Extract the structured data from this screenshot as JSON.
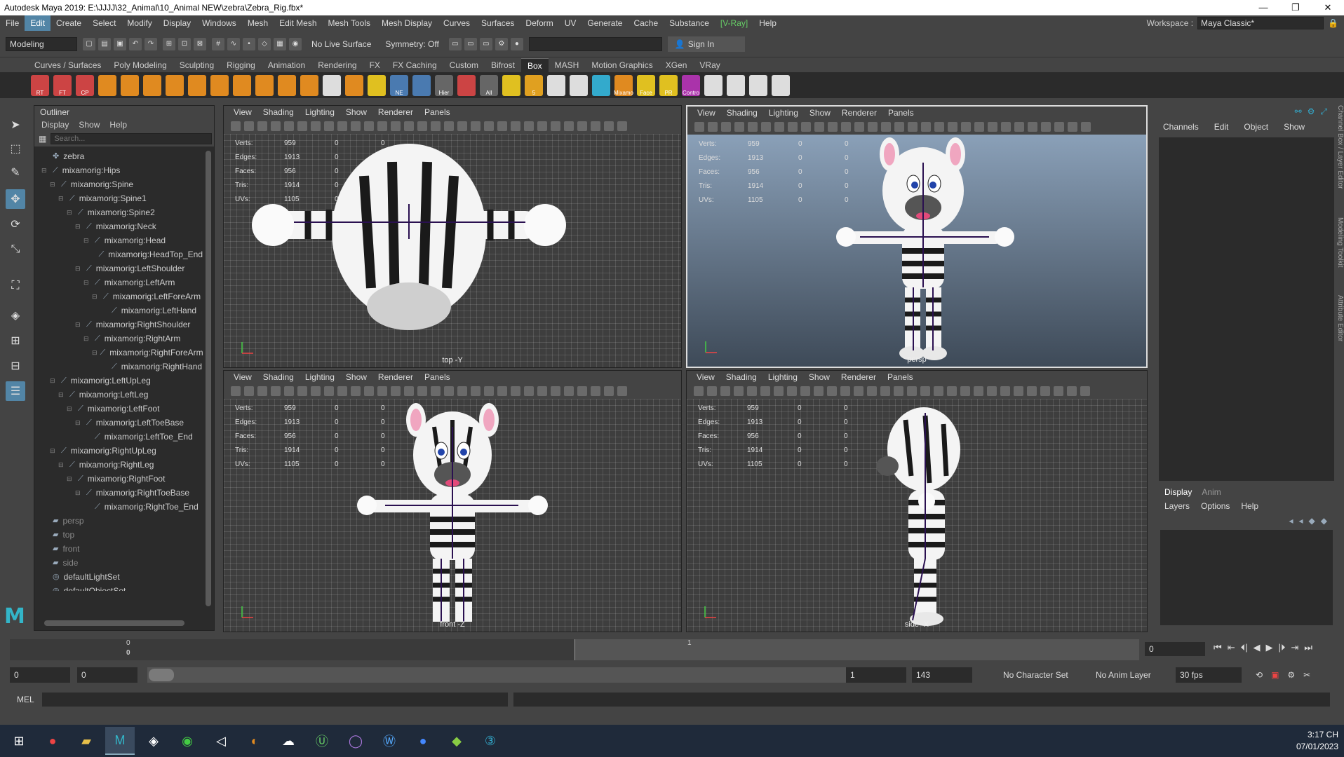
{
  "window": {
    "title": "Autodesk Maya 2019: E:\\JJJJ\\32_Animal\\10_Animal NEW\\zebra\\Zebra_Rig.fbx*",
    "min": "—",
    "max": "❐",
    "close": "✕"
  },
  "menu": [
    "File",
    "Edit",
    "Create",
    "Select",
    "Modify",
    "Display",
    "Windows",
    "Mesh",
    "Edit Mesh",
    "Mesh Tools",
    "Mesh Display",
    "Curves",
    "Surfaces",
    "Deform",
    "UV",
    "Generate",
    "Cache",
    "Substance",
    "[V-Ray]",
    "Help"
  ],
  "workspace": {
    "label": "Workspace :",
    "value": "Maya Classic*"
  },
  "statusline": {
    "mode": "Modeling",
    "live_surface": "No Live Surface",
    "symmetry": "Symmetry: Off",
    "signin": "Sign In"
  },
  "shelf_tabs": [
    "Curves / Surfaces",
    "Poly Modeling",
    "Sculpting",
    "Rigging",
    "Animation",
    "Rendering",
    "FX",
    "FX Caching",
    "Custom",
    "Bifrost",
    "Box",
    "MASH",
    "Motion Graphics",
    "XGen",
    "VRay"
  ],
  "shelf_icons": [
    {
      "label": "RT",
      "color": "#c44"
    },
    {
      "label": "FT",
      "color": "#c44"
    },
    {
      "label": "CP",
      "color": "#c44"
    },
    {
      "label": "",
      "color": "#e08a20"
    },
    {
      "label": "",
      "color": "#e08a20"
    },
    {
      "label": "",
      "color": "#e08a20"
    },
    {
      "label": "",
      "color": "#e08a20"
    },
    {
      "label": "",
      "color": "#e08a20"
    },
    {
      "label": "",
      "color": "#e08a20"
    },
    {
      "label": "",
      "color": "#e08a20"
    },
    {
      "label": "",
      "color": "#e08a20"
    },
    {
      "label": "",
      "color": "#e08a20"
    },
    {
      "label": "",
      "color": "#e08a20"
    },
    {
      "label": "",
      "color": "#ddd"
    },
    {
      "label": "",
      "color": "#e08a20"
    },
    {
      "label": "",
      "color": "#e0c020"
    },
    {
      "label": "NE",
      "color": "#4a7ab0"
    },
    {
      "label": "",
      "color": "#4a7ab0"
    },
    {
      "label": "Hier",
      "color": "#666"
    },
    {
      "label": "",
      "color": "#c44"
    },
    {
      "label": "All",
      "color": "#666"
    },
    {
      "label": "",
      "color": "#e0c020"
    },
    {
      "label": "5",
      "color": "#e0a020"
    },
    {
      "label": "",
      "color": "#ddd"
    },
    {
      "label": "",
      "color": "#ddd"
    },
    {
      "label": "",
      "color": "#3ac"
    },
    {
      "label": "Mixamo",
      "color": "#e08a20"
    },
    {
      "label": "Face",
      "color": "#e0c020"
    },
    {
      "label": "PR",
      "color": "#e0c020"
    },
    {
      "label": "Contro",
      "color": "#a3a"
    },
    {
      "label": "",
      "color": "#ddd"
    },
    {
      "label": "",
      "color": "#ddd"
    },
    {
      "label": "",
      "color": "#ddd"
    },
    {
      "label": "",
      "color": "#ddd"
    }
  ],
  "outliner": {
    "title": "Outliner",
    "menu": [
      "Display",
      "Show",
      "Help"
    ],
    "search_placeholder": "Search...",
    "rows": [
      {
        "label": "zebra",
        "indent": 0,
        "icon": "✤",
        "exp": ""
      },
      {
        "label": "mixamorig:Hips",
        "indent": 0,
        "icon": "⟋",
        "exp": "⊟"
      },
      {
        "label": "mixamorig:Spine",
        "indent": 1,
        "icon": "⟋",
        "exp": "⊟"
      },
      {
        "label": "mixamorig:Spine1",
        "indent": 2,
        "icon": "⟋",
        "exp": "⊟"
      },
      {
        "label": "mixamorig:Spine2",
        "indent": 3,
        "icon": "⟋",
        "exp": "⊟"
      },
      {
        "label": "mixamorig:Neck",
        "indent": 4,
        "icon": "⟋",
        "exp": "⊟"
      },
      {
        "label": "mixamorig:Head",
        "indent": 5,
        "icon": "⟋",
        "exp": "⊟"
      },
      {
        "label": "mixamorig:HeadTop_End",
        "indent": 6,
        "icon": "⟋",
        "exp": ""
      },
      {
        "label": "mixamorig:LeftShoulder",
        "indent": 4,
        "icon": "⟋",
        "exp": "⊟"
      },
      {
        "label": "mixamorig:LeftArm",
        "indent": 5,
        "icon": "⟋",
        "exp": "⊟"
      },
      {
        "label": "mixamorig:LeftForeArm",
        "indent": 6,
        "icon": "⟋",
        "exp": "⊟"
      },
      {
        "label": "mixamorig:LeftHand",
        "indent": 7,
        "icon": "⟋",
        "exp": ""
      },
      {
        "label": "mixamorig:RightShoulder",
        "indent": 4,
        "icon": "⟋",
        "exp": "⊟"
      },
      {
        "label": "mixamorig:RightArm",
        "indent": 5,
        "icon": "⟋",
        "exp": "⊟"
      },
      {
        "label": "mixamorig:RightForeArm",
        "indent": 6,
        "icon": "⟋",
        "exp": "⊟"
      },
      {
        "label": "mixamorig:RightHand",
        "indent": 7,
        "icon": "⟋",
        "exp": ""
      },
      {
        "label": "mixamorig:LeftUpLeg",
        "indent": 1,
        "icon": "⟋",
        "exp": "⊟"
      },
      {
        "label": "mixamorig:LeftLeg",
        "indent": 2,
        "icon": "⟋",
        "exp": "⊟"
      },
      {
        "label": "mixamorig:LeftFoot",
        "indent": 3,
        "icon": "⟋",
        "exp": "⊟"
      },
      {
        "label": "mixamorig:LeftToeBase",
        "indent": 4,
        "icon": "⟋",
        "exp": "⊟"
      },
      {
        "label": "mixamorig:LeftToe_End",
        "indent": 5,
        "icon": "⟋",
        "exp": ""
      },
      {
        "label": "mixamorig:RightUpLeg",
        "indent": 1,
        "icon": "⟋",
        "exp": "⊟"
      },
      {
        "label": "mixamorig:RightLeg",
        "indent": 2,
        "icon": "⟋",
        "exp": "⊟"
      },
      {
        "label": "mixamorig:RightFoot",
        "indent": 3,
        "icon": "⟋",
        "exp": "⊟"
      },
      {
        "label": "mixamorig:RightToeBase",
        "indent": 4,
        "icon": "⟋",
        "exp": "⊟"
      },
      {
        "label": "mixamorig:RightToe_End",
        "indent": 5,
        "icon": "⟋",
        "exp": ""
      },
      {
        "label": "persp",
        "indent": 0,
        "icon": "▰",
        "exp": "",
        "dim": true
      },
      {
        "label": "top",
        "indent": 0,
        "icon": "▰",
        "exp": "",
        "dim": true
      },
      {
        "label": "front",
        "indent": 0,
        "icon": "▰",
        "exp": "",
        "dim": true
      },
      {
        "label": "side",
        "indent": 0,
        "icon": "▰",
        "exp": "",
        "dim": true
      },
      {
        "label": "defaultLightSet",
        "indent": 0,
        "icon": "◎",
        "exp": ""
      },
      {
        "label": "defaultObjectSet",
        "indent": 0,
        "icon": "◎",
        "exp": ""
      }
    ]
  },
  "viewport_menu": [
    "View",
    "Shading",
    "Lighting",
    "Show",
    "Renderer",
    "Panels"
  ],
  "hud": {
    "rows": [
      {
        "k": "Verts:",
        "v": "959",
        "a": "0",
        "b": "0"
      },
      {
        "k": "Edges:",
        "v": "1913",
        "a": "0",
        "b": "0"
      },
      {
        "k": "Faces:",
        "v": "956",
        "a": "0",
        "b": "0"
      },
      {
        "k": "Tris:",
        "v": "1914",
        "a": "0",
        "b": "0"
      },
      {
        "k": "UVs:",
        "v": "1105",
        "a": "0",
        "b": "0"
      }
    ]
  },
  "viewports": {
    "top": "top -Y",
    "persp": "persp",
    "front": "front -Z",
    "side": "side -X"
  },
  "channelbox": {
    "menu": [
      "Channels",
      "Edit",
      "Object",
      "Show"
    ],
    "tabs": [
      "Display",
      "Anim"
    ],
    "sub": [
      "Layers",
      "Options",
      "Help"
    ]
  },
  "side_tabs": [
    "Channel Box / Layer Editor",
    "Modeling Toolkit",
    "Attribute Editor"
  ],
  "timeslider": {
    "tick0": "0",
    "tick1": "1",
    "current": "0",
    "frame_field": "0",
    "controls": [
      "⏮",
      "⇤",
      "⏴|",
      "◀",
      "▶",
      "|⏵",
      "⇥",
      "⏭"
    ]
  },
  "range": {
    "start": "0",
    "anim_start": "0",
    "anim_end": "1",
    "end": "143",
    "char_set": "No Character Set",
    "anim_layer": "No Anim Layer",
    "fps": "30 fps"
  },
  "cmd": {
    "label": "MEL"
  },
  "taskbar": {
    "time": "3:17 CH",
    "date": "07/01/2023"
  }
}
